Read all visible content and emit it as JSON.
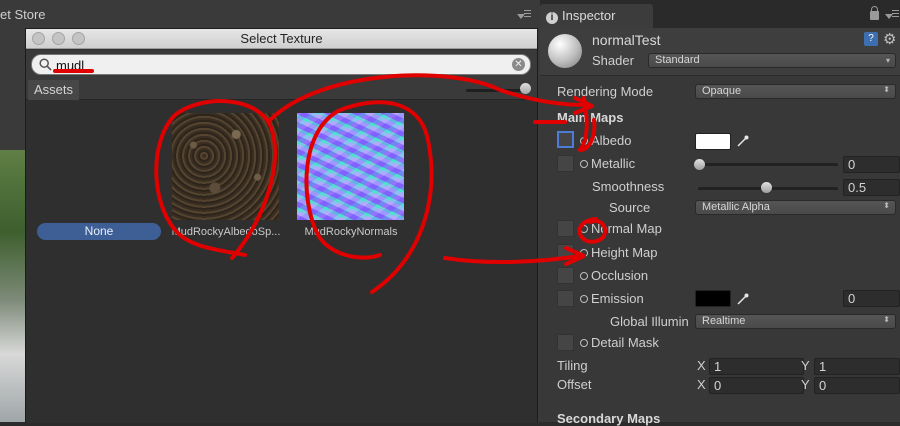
{
  "background": {
    "asset_store_tab": "et Store"
  },
  "texture_window": {
    "title": "Select Texture",
    "search": {
      "value": "mudl",
      "placeholder": ""
    },
    "assets_tab": "Assets",
    "none_label": "None",
    "items": [
      {
        "label": "MudRockyAlbedoSp..."
      },
      {
        "label": "MudRockyNormals"
      }
    ]
  },
  "inspector": {
    "tab_label": "Inspector",
    "material_name": "normalTest",
    "shader_label": "Shader",
    "shader_value": "Standard",
    "rendering_mode_label": "Rendering Mode",
    "rendering_mode_value": "Opaque",
    "main_maps_header": "Main Maps",
    "albedo_label": "Albedo",
    "albedo_color": "#ffffff",
    "metallic_label": "Metallic",
    "metallic_value": "0",
    "metallic_level": 0,
    "smoothness_label": "Smoothness",
    "smoothness_value": "0.5",
    "smoothness_level": 0.5,
    "source_label": "Source",
    "source_value": "Metallic Alpha",
    "normal_map_label": "Normal Map",
    "height_map_label": "Height Map",
    "occlusion_label": "Occlusion",
    "emission_label": "Emission",
    "emission_color": "#000000",
    "emission_value": "0",
    "global_illum_label": "Global Illumin",
    "global_illum_value": "Realtime",
    "detail_mask_label": "Detail Mask",
    "tiling_label": "Tiling",
    "offset_label": "Offset",
    "tiling_x": "1",
    "tiling_y": "1",
    "offset_x": "0",
    "offset_y": "0",
    "x_label": "X",
    "y_label": "Y",
    "secondary_maps_header": "Secondary Maps"
  },
  "colors": {
    "annotation": "#e00000",
    "selection_blue": "#3e5f96"
  }
}
